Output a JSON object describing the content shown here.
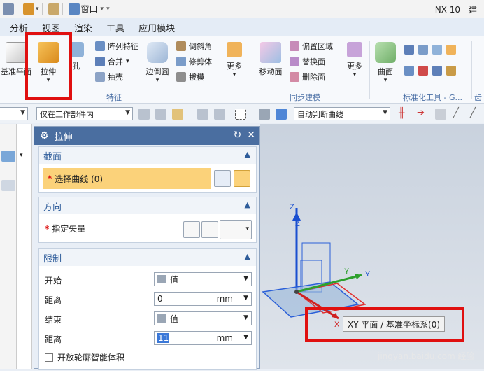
{
  "titlebar": {
    "window_menu": "窗口",
    "app_title": "NX 10 - 建"
  },
  "menubar": [
    "分析",
    "视图",
    "渲染",
    "工具",
    "应用模块"
  ],
  "ribbon": {
    "datum_plane": "基准平面",
    "extrude": "拉伸",
    "hole": "孔",
    "pattern_feature": "阵列特征",
    "unite": "合并",
    "shell": "抽壳",
    "edge_blend": "边倒圆",
    "chamfer": "倒斜角",
    "trim_body": "修剪体",
    "draft": "拔模",
    "more1": "更多",
    "group_feature": "特征",
    "move_face": "移动面",
    "offset_region": "偏置区域",
    "replace_face": "替换面",
    "delete_face": "删除面",
    "more2": "更多",
    "group_sync": "同步建模",
    "surface": "曲面",
    "group_std": "标准化工具 - G...",
    "group_gear": "齿轮"
  },
  "selbar": {
    "scope": "仅在工作部件内",
    "curve_rule": "自动判断曲线"
  },
  "dialog": {
    "title": "拉伸",
    "section_label": "截面",
    "select_curve": "选择曲线 (0)",
    "direction_label": "方向",
    "specify_vector": "指定矢量",
    "limits_label": "限制",
    "start_label": "开始",
    "start_value": "值",
    "distance_label": "距离",
    "start_distance": "0",
    "unit": "mm",
    "end_label": "结束",
    "end_value": "值",
    "end_distance_label": "距离",
    "end_distance": "11",
    "open_profile": "开放轮廓智能体积"
  },
  "viewport": {
    "axis_z": "Z",
    "axis_y": "Y",
    "axis_x": "X",
    "tooltip": "XY 平面 / 基准坐标系(0)",
    "watermark": "jingyan.baidu.com 经验"
  }
}
